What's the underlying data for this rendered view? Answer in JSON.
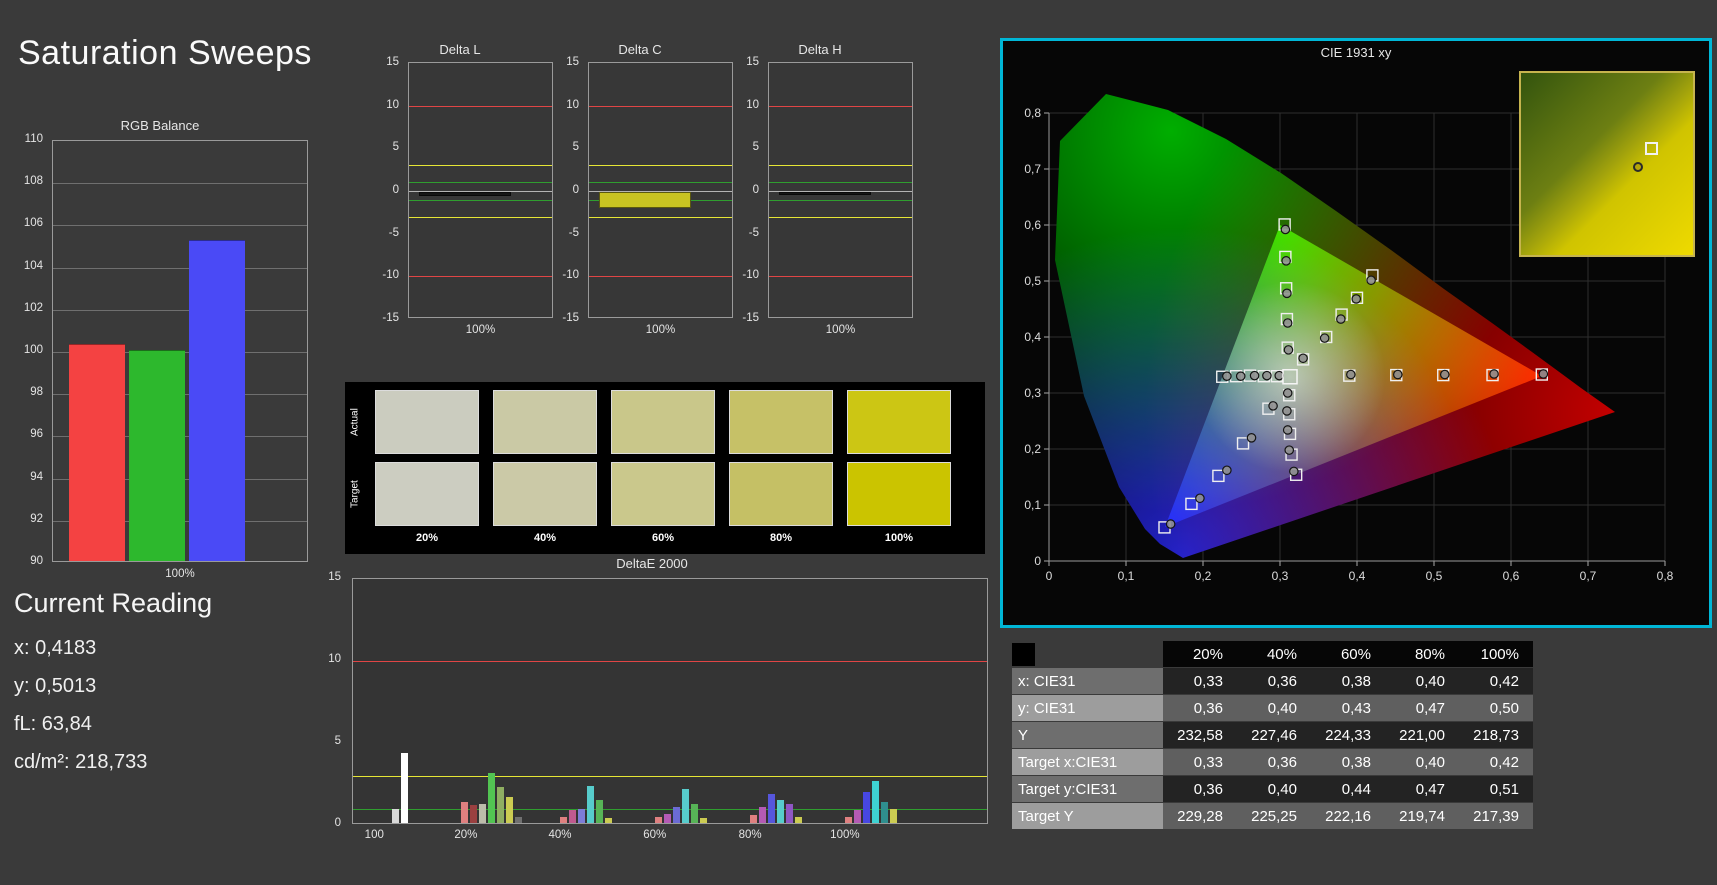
{
  "page": {
    "title": "Saturation Sweeps"
  },
  "rgb_balance": {
    "title": "RGB Balance",
    "xlabel": "100%",
    "ymin": 90,
    "ymax": 110,
    "yticks": [
      110,
      108,
      106,
      104,
      102,
      100,
      98,
      96,
      94,
      92,
      90
    ],
    "bars": [
      {
        "name": "red",
        "value": 100.4,
        "color": "#f44242"
      },
      {
        "name": "green",
        "value": 100.1,
        "color": "#2db82d"
      },
      {
        "name": "blue",
        "value": 105.3,
        "color": "#4a4af6"
      }
    ]
  },
  "reading": {
    "title": "Current Reading",
    "x": "x: 0,4183",
    "y": "y: 0,5013",
    "fl": "fL: 63,84",
    "cdm2": "cd/m²: 218,733"
  },
  "delta_charts": {
    "ymin": -15,
    "ymax": 15,
    "yticks": [
      15,
      10,
      5,
      0,
      -5,
      -10,
      -15
    ],
    "ref_lines": [
      {
        "value": 10,
        "color": "#e04545"
      },
      {
        "value": -10,
        "color": "#e04545"
      },
      {
        "value": 3,
        "color": "#e6e635"
      },
      {
        "value": -3,
        "color": "#e6e635"
      },
      {
        "value": 1,
        "color": "#2f9e2f"
      },
      {
        "value": -1,
        "color": "#2f9e2f"
      }
    ],
    "charts": [
      {
        "title": "Delta L",
        "xlabel": "100%",
        "value": -0.5,
        "bar_color": "#161616"
      },
      {
        "title": "Delta C",
        "xlabel": "100%",
        "value": -1.9,
        "bar_color": "#c8c322"
      },
      {
        "title": "Delta H",
        "xlabel": "100%",
        "value": -0.4,
        "bar_color": "#161616"
      }
    ]
  },
  "swatch_panel": {
    "row_labels": [
      "Actual",
      "Target"
    ],
    "col_labels": [
      "20%",
      "40%",
      "60%",
      "80%",
      "100%"
    ],
    "actual": [
      "#cbccbf",
      "#cac9a5",
      "#c9c78a",
      "#c6c167",
      "#ccc614"
    ],
    "target": [
      "#cccdc1",
      "#cbc9a7",
      "#cac88c",
      "#c5c065",
      "#cbc400"
    ]
  },
  "deltae": {
    "title": "DeltaE 2000",
    "ymin": 0,
    "ymax": 15,
    "yticks": [
      15,
      10,
      5,
      0
    ],
    "ref_lines": [
      {
        "value": 10,
        "color": "#e04545"
      },
      {
        "value": 3,
        "color": "#e6e635"
      },
      {
        "value": 1,
        "color": "#2f9e2f"
      }
    ],
    "groups": [
      {
        "label": "100",
        "bars": [
          {
            "color": "#d8d8d8",
            "value": 1.0
          },
          {
            "color": "#ffffff",
            "value": 4.4
          }
        ]
      },
      {
        "label": "20%",
        "bars": [
          {
            "color": "#df8080",
            "value": 1.4
          },
          {
            "color": "#9a4040",
            "value": 1.2
          },
          {
            "color": "#bcbcaa",
            "value": 1.3
          },
          {
            "color": "#52c452",
            "value": 3.2
          },
          {
            "color": "#8fae62",
            "value": 2.3
          },
          {
            "color": "#cbcb52",
            "value": 1.7
          },
          {
            "color": "#707070",
            "value": 0.5
          }
        ]
      },
      {
        "label": "40%",
        "bars": [
          {
            "color": "#df8080",
            "value": 0.5
          },
          {
            "color": "#c05a8f",
            "value": 0.9
          },
          {
            "color": "#7d7dd8",
            "value": 1.0
          },
          {
            "color": "#57cccc",
            "value": 2.4
          },
          {
            "color": "#57b457",
            "value": 1.5
          },
          {
            "color": "#cbcb52",
            "value": 0.4
          }
        ]
      },
      {
        "label": "60%",
        "bars": [
          {
            "color": "#df8080",
            "value": 0.5
          },
          {
            "color": "#b45ab4",
            "value": 0.7
          },
          {
            "color": "#6b6bd4",
            "value": 1.1
          },
          {
            "color": "#57cccc",
            "value": 2.2
          },
          {
            "color": "#57b457",
            "value": 1.3
          },
          {
            "color": "#cbcb52",
            "value": 0.4
          }
        ]
      },
      {
        "label": "80%",
        "bars": [
          {
            "color": "#df8080",
            "value": 0.6
          },
          {
            "color": "#b45ab4",
            "value": 1.1
          },
          {
            "color": "#5656dc",
            "value": 1.9
          },
          {
            "color": "#57cccc",
            "value": 1.5
          },
          {
            "color": "#8f57c4",
            "value": 1.3
          },
          {
            "color": "#cbcb52",
            "value": 0.5
          }
        ]
      },
      {
        "label": "100%",
        "bars": [
          {
            "color": "#df8080",
            "value": 0.5
          },
          {
            "color": "#b45ab4",
            "value": 0.9
          },
          {
            "color": "#4747e2",
            "value": 2.0
          },
          {
            "color": "#3ed2d2",
            "value": 2.7
          },
          {
            "color": "#2f8f8f",
            "value": 1.4
          },
          {
            "color": "#cbcb52",
            "value": 1.0
          }
        ]
      }
    ]
  },
  "cie": {
    "title": "CIE 1931 xy",
    "xticks": [
      "0",
      "0,1",
      "0,2",
      "0,3",
      "0,4",
      "0,5",
      "0,6",
      "0,7",
      "0,8"
    ],
    "yticks": [
      "0",
      "0,1",
      "0,2",
      "0,3",
      "0,4",
      "0,5",
      "0,6",
      "0,7",
      "0,8"
    ],
    "white_target": [
      0.313,
      0.329
    ],
    "targets": [
      [
        0.39,
        0.331
      ],
      [
        0.451,
        0.332
      ],
      [
        0.512,
        0.332
      ],
      [
        0.576,
        0.332
      ],
      [
        0.64,
        0.333
      ],
      [
        0.31,
        0.381
      ],
      [
        0.309,
        0.432
      ],
      [
        0.308,
        0.487
      ],
      [
        0.307,
        0.543
      ],
      [
        0.306,
        0.601
      ],
      [
        0.285,
        0.272
      ],
      [
        0.252,
        0.21
      ],
      [
        0.22,
        0.152
      ],
      [
        0.185,
        0.102
      ],
      [
        0.15,
        0.06
      ],
      [
        0.296,
        0.33
      ],
      [
        0.279,
        0.33
      ],
      [
        0.261,
        0.331
      ],
      [
        0.243,
        0.33
      ],
      [
        0.225,
        0.329
      ],
      [
        0.312,
        0.296
      ],
      [
        0.312,
        0.262
      ],
      [
        0.313,
        0.227
      ],
      [
        0.315,
        0.19
      ],
      [
        0.321,
        0.154
      ],
      [
        0.33,
        0.36
      ],
      [
        0.36,
        0.4
      ],
      [
        0.38,
        0.44
      ],
      [
        0.4,
        0.47
      ],
      [
        0.42,
        0.51
      ]
    ],
    "measured": [
      [
        0.392,
        0.333
      ],
      [
        0.453,
        0.333
      ],
      [
        0.514,
        0.333
      ],
      [
        0.578,
        0.334
      ],
      [
        0.642,
        0.334
      ],
      [
        0.311,
        0.377
      ],
      [
        0.31,
        0.425
      ],
      [
        0.309,
        0.478
      ],
      [
        0.308,
        0.536
      ],
      [
        0.307,
        0.592
      ],
      [
        0.291,
        0.277
      ],
      [
        0.263,
        0.22
      ],
      [
        0.231,
        0.162
      ],
      [
        0.196,
        0.112
      ],
      [
        0.158,
        0.066
      ],
      [
        0.299,
        0.331
      ],
      [
        0.283,
        0.331
      ],
      [
        0.267,
        0.331
      ],
      [
        0.249,
        0.33
      ],
      [
        0.231,
        0.33
      ],
      [
        0.31,
        0.3
      ],
      [
        0.309,
        0.268
      ],
      [
        0.31,
        0.234
      ],
      [
        0.312,
        0.198
      ],
      [
        0.318,
        0.16
      ],
      [
        0.33,
        0.362
      ],
      [
        0.358,
        0.398
      ],
      [
        0.379,
        0.432
      ],
      [
        0.399,
        0.468
      ],
      [
        0.4183,
        0.5013
      ]
    ],
    "inset": {
      "square": [
        0.76,
        0.42
      ],
      "circle": [
        0.69,
        0.53
      ]
    }
  },
  "table": {
    "col_headers": [
      "20%",
      "40%",
      "60%",
      "80%",
      "100%"
    ],
    "rows": [
      {
        "label": "x: CIE31",
        "values": [
          "0,33",
          "0,36",
          "0,38",
          "0,40",
          "0,42"
        ]
      },
      {
        "label": "y: CIE31",
        "values": [
          "0,36",
          "0,40",
          "0,43",
          "0,47",
          "0,50"
        ]
      },
      {
        "label": "Y",
        "values": [
          "232,58",
          "227,46",
          "224,33",
          "221,00",
          "218,73"
        ]
      },
      {
        "label": "Target x:CIE31",
        "values": [
          "0,33",
          "0,36",
          "0,38",
          "0,40",
          "0,42"
        ]
      },
      {
        "label": "Target y:CIE31",
        "values": [
          "0,36",
          "0,40",
          "0,44",
          "0,47",
          "0,51"
        ]
      },
      {
        "label": "Target Y",
        "values": [
          "229,28",
          "225,25",
          "222,16",
          "219,74",
          "217,39"
        ]
      }
    ]
  }
}
